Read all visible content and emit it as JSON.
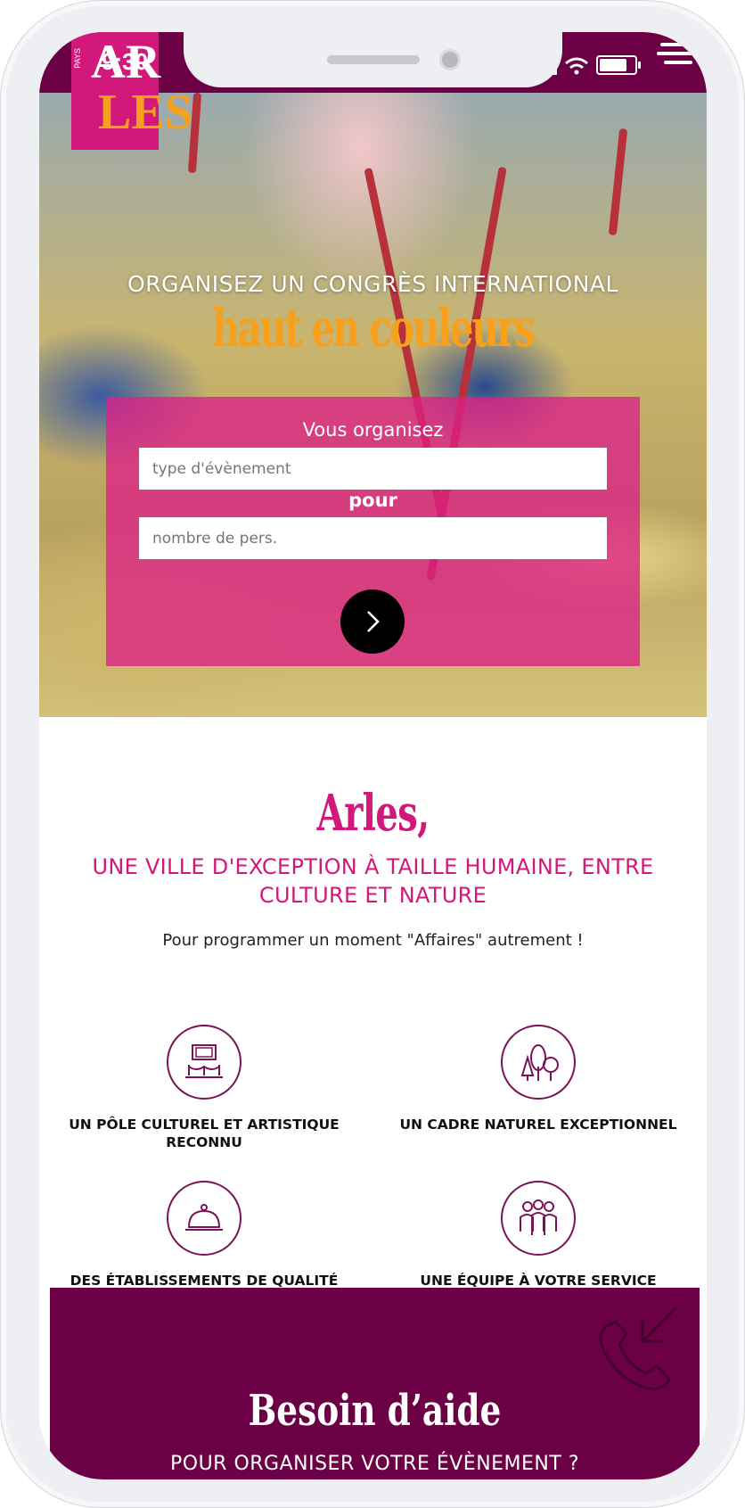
{
  "status_bar": {
    "time": "9:30"
  },
  "logo": {
    "small": "PAYS",
    "top": "AR",
    "bottom": "LES"
  },
  "hero": {
    "title": "ORGANISEZ UN CONGRÈS INTERNATIONAL",
    "subtitle": "haut en couleurs",
    "form": {
      "label1": "Vous organisez",
      "event_type_placeholder": "type d'évènement",
      "label2": "pour",
      "people_placeholder": "nombre de pers."
    }
  },
  "intro": {
    "heading": "Arles,",
    "tagline": "UNE VILLE D'EXCEPTION À TAILLE HUMAINE, ENTRE CULTURE ET NATURE",
    "text": "Pour programmer un moment \"Affaires\" autrement !"
  },
  "features": [
    {
      "label": "UN PÔLE CULTUREL ET ARTISTIQUE RECONNU",
      "icon": "museum-icon"
    },
    {
      "label": "UN CADRE NATUREL EXCEPTIONNEL",
      "icon": "trees-icon"
    },
    {
      "label": "DES ÉTABLISSEMENTS DE QUALITÉ",
      "icon": "cloche-icon"
    },
    {
      "label": "UNE ÉQUIPE À VOTRE SERVICE",
      "icon": "team-icon"
    }
  ],
  "help": {
    "title": "Besoin d’aide",
    "subtitle": "POUR ORGANISER VOTRE ÉVÈNEMENT ?"
  },
  "colors": {
    "brand_pink": "#d2187a",
    "brand_plum": "#6b0045",
    "accent_orange": "#f6a01d"
  }
}
